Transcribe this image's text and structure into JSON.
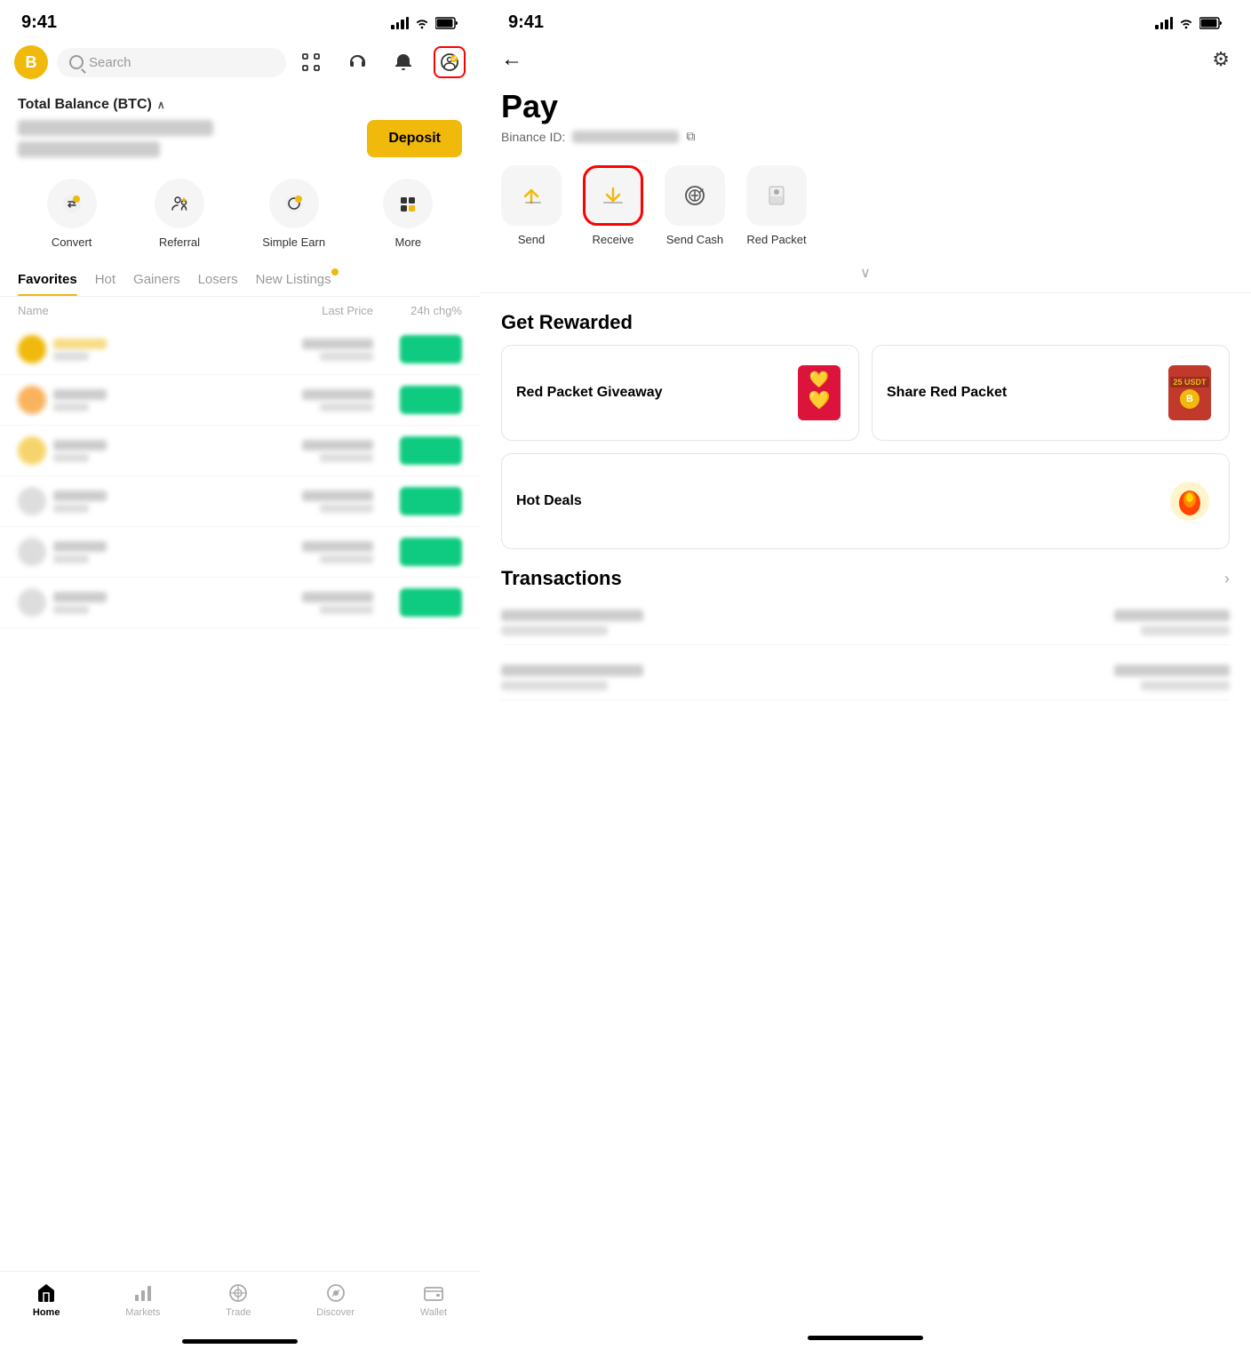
{
  "leftScreen": {
    "statusBar": {
      "time": "9:41"
    },
    "topNav": {
      "searchPlaceholder": "Search"
    },
    "balanceSection": {
      "title": "Total Balance (BTC)",
      "depositLabel": "Deposit"
    },
    "quickActions": [
      {
        "id": "convert",
        "label": "Convert",
        "icon": "🔄"
      },
      {
        "id": "referral",
        "label": "Referral",
        "icon": "👥"
      },
      {
        "id": "simple-earn",
        "label": "Simple Earn",
        "icon": "📈"
      },
      {
        "id": "more",
        "label": "More",
        "icon": "⋯"
      }
    ],
    "marketTabs": [
      {
        "id": "favorites",
        "label": "Favorites",
        "active": true
      },
      {
        "id": "hot",
        "label": "Hot",
        "active": false
      },
      {
        "id": "gainers",
        "label": "Gainers",
        "active": false
      },
      {
        "id": "losers",
        "label": "Losers",
        "active": false
      },
      {
        "id": "new-listings",
        "label": "New Listings",
        "active": false
      }
    ],
    "tableHeaders": {
      "name": "Name",
      "lastPrice": "Last Price",
      "change": "24h chg%"
    },
    "bottomNav": [
      {
        "id": "home",
        "label": "Home",
        "active": true,
        "icon": "🏠"
      },
      {
        "id": "markets",
        "label": "Markets",
        "active": false,
        "icon": "📊"
      },
      {
        "id": "trade",
        "label": "Trade",
        "active": false,
        "icon": "🔄"
      },
      {
        "id": "discover",
        "label": "Discover",
        "active": false,
        "icon": "🔍"
      },
      {
        "id": "wallet",
        "label": "Wallet",
        "active": false,
        "icon": "👛"
      }
    ]
  },
  "rightScreen": {
    "statusBar": {
      "time": "9:41"
    },
    "pageTitle": "Pay",
    "binanceId": {
      "label": "Binance ID:"
    },
    "payActions": [
      {
        "id": "send",
        "label": "Send",
        "icon": "⬆",
        "highlighted": false
      },
      {
        "id": "receive",
        "label": "Receive",
        "icon": "⬇",
        "highlighted": true
      },
      {
        "id": "send-cash",
        "label": "Send Cash",
        "icon": "💵",
        "highlighted": false
      },
      {
        "id": "red-packet",
        "label": "Red Packet",
        "icon": "🧧",
        "highlighted": false
      }
    ],
    "getRewardedSection": {
      "title": "Get Rewarded",
      "cards": [
        {
          "id": "red-packet-giveaway",
          "title": "Red Packet Giveaway",
          "iconType": "red-packet"
        },
        {
          "id": "share-red-packet",
          "title": "Share Red Packet",
          "iconType": "share-red-packet"
        },
        {
          "id": "hot-deals",
          "title": "Hot Deals",
          "iconType": "hot-deals"
        }
      ]
    },
    "transactionsSection": {
      "title": "Transactions"
    }
  }
}
